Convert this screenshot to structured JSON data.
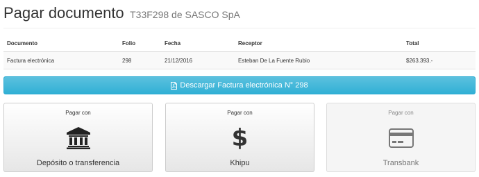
{
  "header": {
    "title": "Pagar documento",
    "subtitle": "T33F298 de SASCO SpA"
  },
  "table": {
    "columns": [
      "Documento",
      "Folio",
      "Fecha",
      "Receptor",
      "Total"
    ],
    "row": {
      "documento": "Factura electrónica",
      "folio": "298",
      "fecha": "21/12/2016",
      "receptor": "Esteban De La Fuente Rubio",
      "total": "$263.393.-"
    }
  },
  "download": {
    "icon": "file-pdf-icon",
    "label": "Descargar Factura electrónica N° 298",
    "color": "#5bc0de"
  },
  "payment_options": [
    {
      "caption": "Pagar con",
      "name": "Depósito o transferencia",
      "icon": "bank-icon",
      "enabled": true
    },
    {
      "caption": "Pagar con",
      "name": "Khipu",
      "icon": "dollar-icon",
      "glyph": "$",
      "enabled": true
    },
    {
      "caption": "Pagar con",
      "name": "Transbank",
      "icon": "credit-card-icon",
      "enabled": false
    }
  ]
}
